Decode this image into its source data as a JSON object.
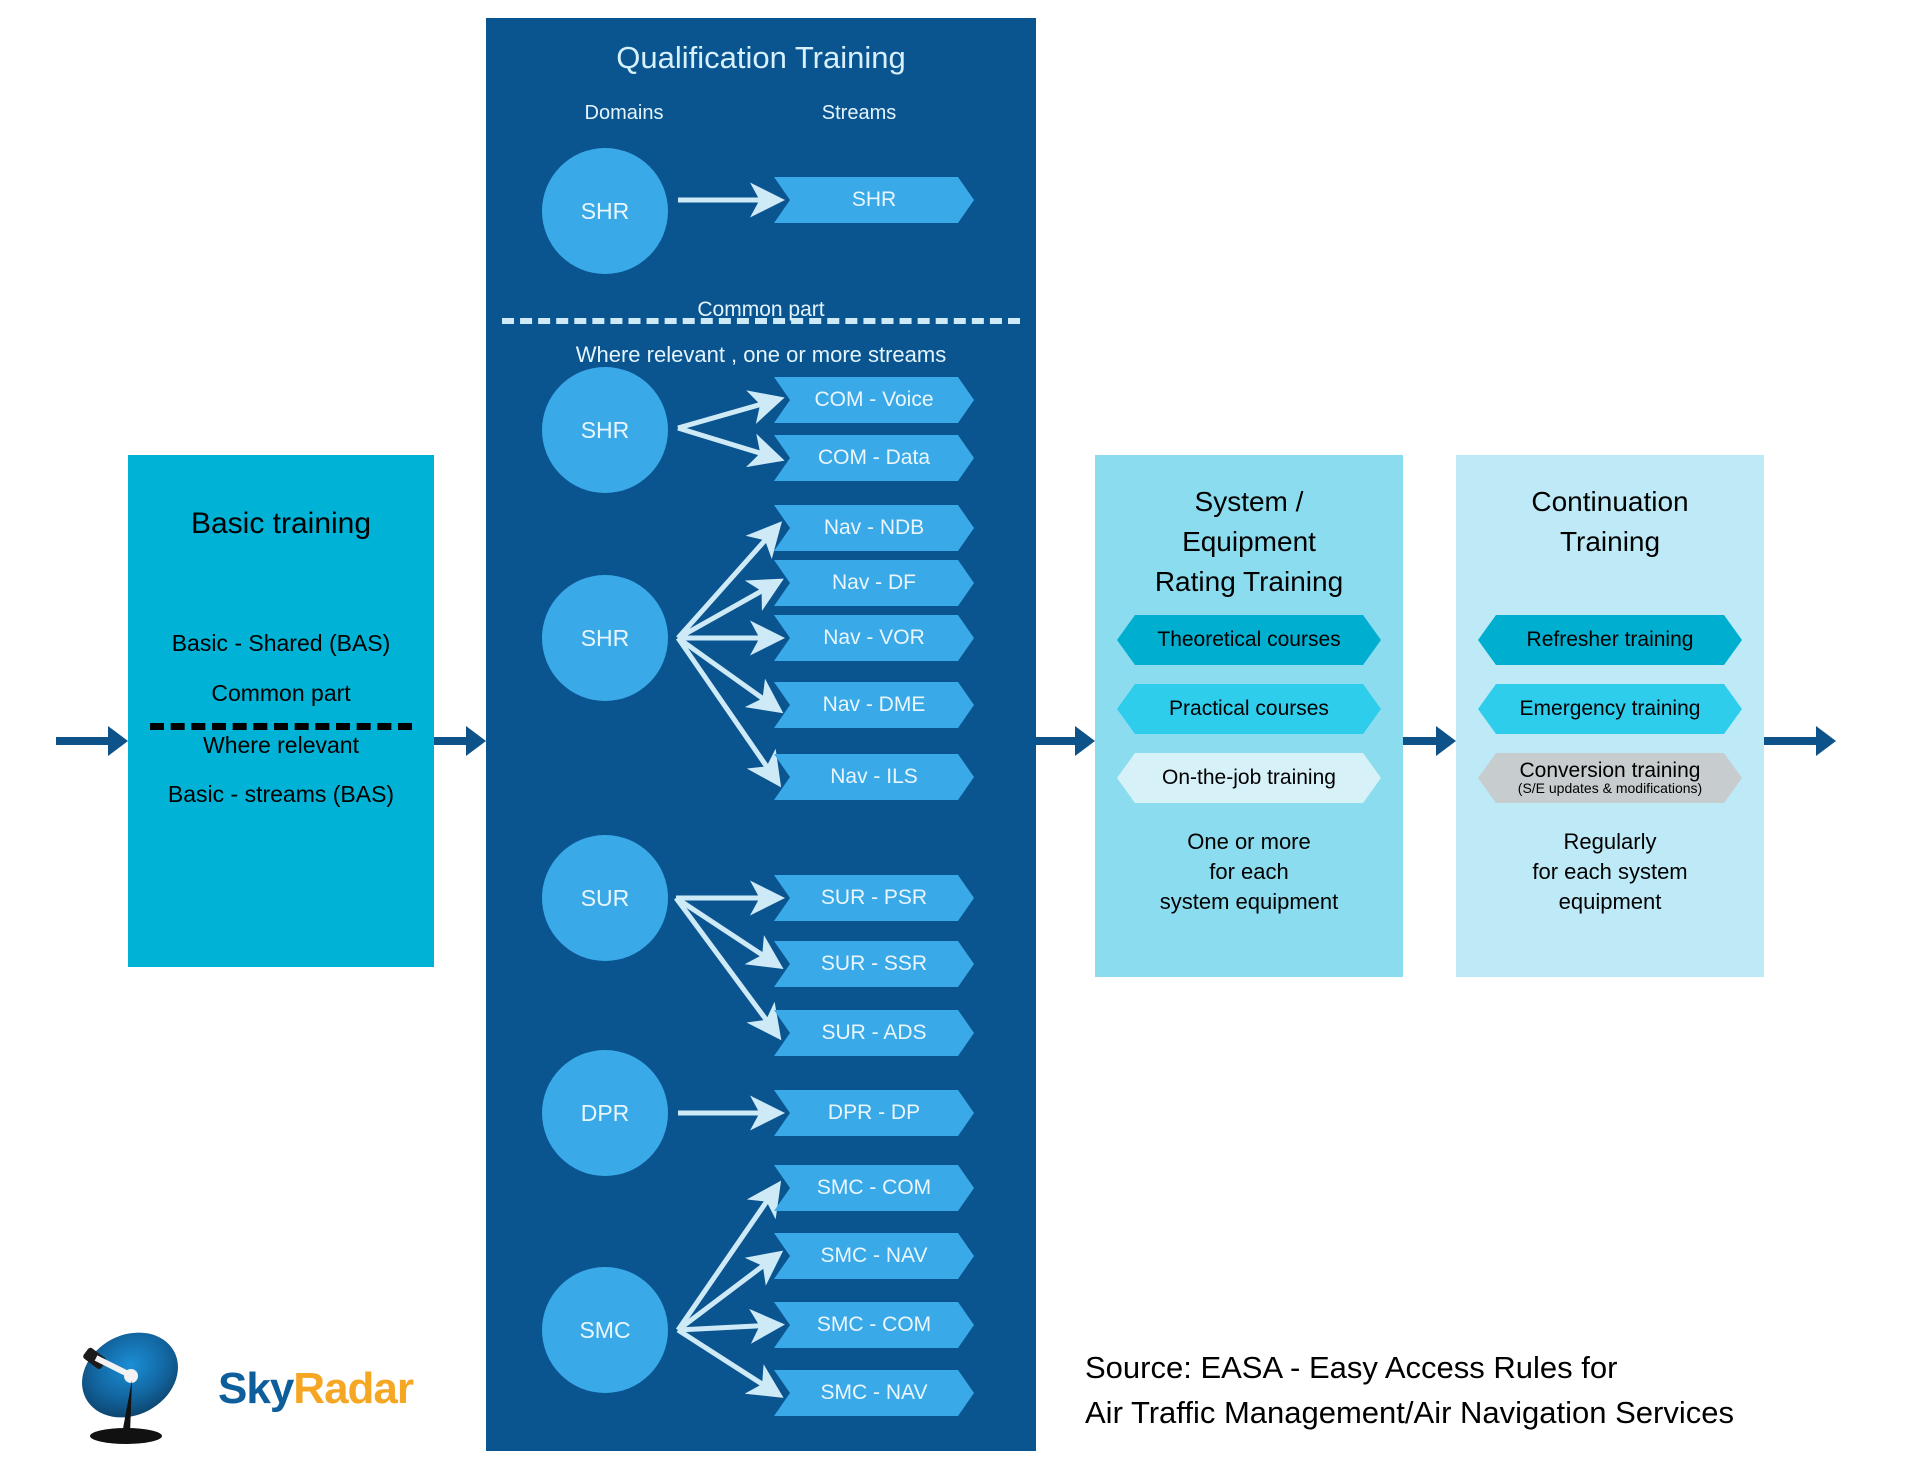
{
  "basic": {
    "title": "Basic training",
    "line1": "Basic - Shared (BAS)",
    "line2": "Common part",
    "line3": "Where relevant",
    "line4": "Basic - streams (BAS)"
  },
  "qualification": {
    "title": "Qualification Training",
    "domains_label": "Domains",
    "streams_label": "Streams",
    "common_part_label": "Common part",
    "where_relevant_label": "Where relevant , one or more streams",
    "common": {
      "domain": "SHR",
      "stream": "SHR"
    },
    "groups": [
      {
        "domain": "SHR",
        "streams": [
          "COM - Voice",
          "COM - Data"
        ]
      },
      {
        "domain": "SHR",
        "streams": [
          "Nav - NDB",
          "Nav - DF",
          "Nav - VOR",
          "Nav - DME",
          "Nav - ILS"
        ]
      },
      {
        "domain": "SUR",
        "streams": [
          "SUR - PSR",
          "SUR - SSR",
          "SUR - ADS"
        ]
      },
      {
        "domain": "DPR",
        "streams": [
          "DPR - DP"
        ]
      },
      {
        "domain": "SMC",
        "streams": [
          "SMC - COM",
          "SMC - NAV",
          "SMC - COM",
          "SMC - NAV"
        ]
      }
    ]
  },
  "system_panel": {
    "title_line1": "System /",
    "title_line2": "Equipment",
    "title_line3": "Rating Training",
    "chips": [
      {
        "label": "Theoretical courses",
        "color": "#00aed0"
      },
      {
        "label": "Practical courses",
        "color": "#2ecdec"
      },
      {
        "label": "On-the-job training",
        "color": "#d7f1f9"
      }
    ],
    "note_line1": "One or more",
    "note_line2": "for each",
    "note_line3": "system equipment"
  },
  "continuation_panel": {
    "title_line1": "Continuation",
    "title_line2": "Training",
    "chips": [
      {
        "label": "Refresher training",
        "sub": "",
        "color": "#00aed0"
      },
      {
        "label": "Emergency training",
        "sub": "",
        "color": "#2ecdec"
      },
      {
        "label": "Conversion training",
        "sub": "(S/E updates & modifications)",
        "color": "#c7cdcf"
      }
    ],
    "note_line1": "Regularly",
    "note_line2": "for each system",
    "note_line3": "equipment"
  },
  "footer": {
    "source_line1": "Source: EASA -  Easy Access Rules for",
    "source_line2": "Air Traffic Management/Air Navigation Services",
    "logo_sky": "Sky",
    "logo_radar": "Radar"
  },
  "colors": {
    "panel_dark_blue": "#0a5590",
    "basic_cyan": "#00b2d6",
    "node_blue": "#3aa9e8",
    "arrow_blue": "#0d5289",
    "light_text": "#eaf6fd"
  }
}
